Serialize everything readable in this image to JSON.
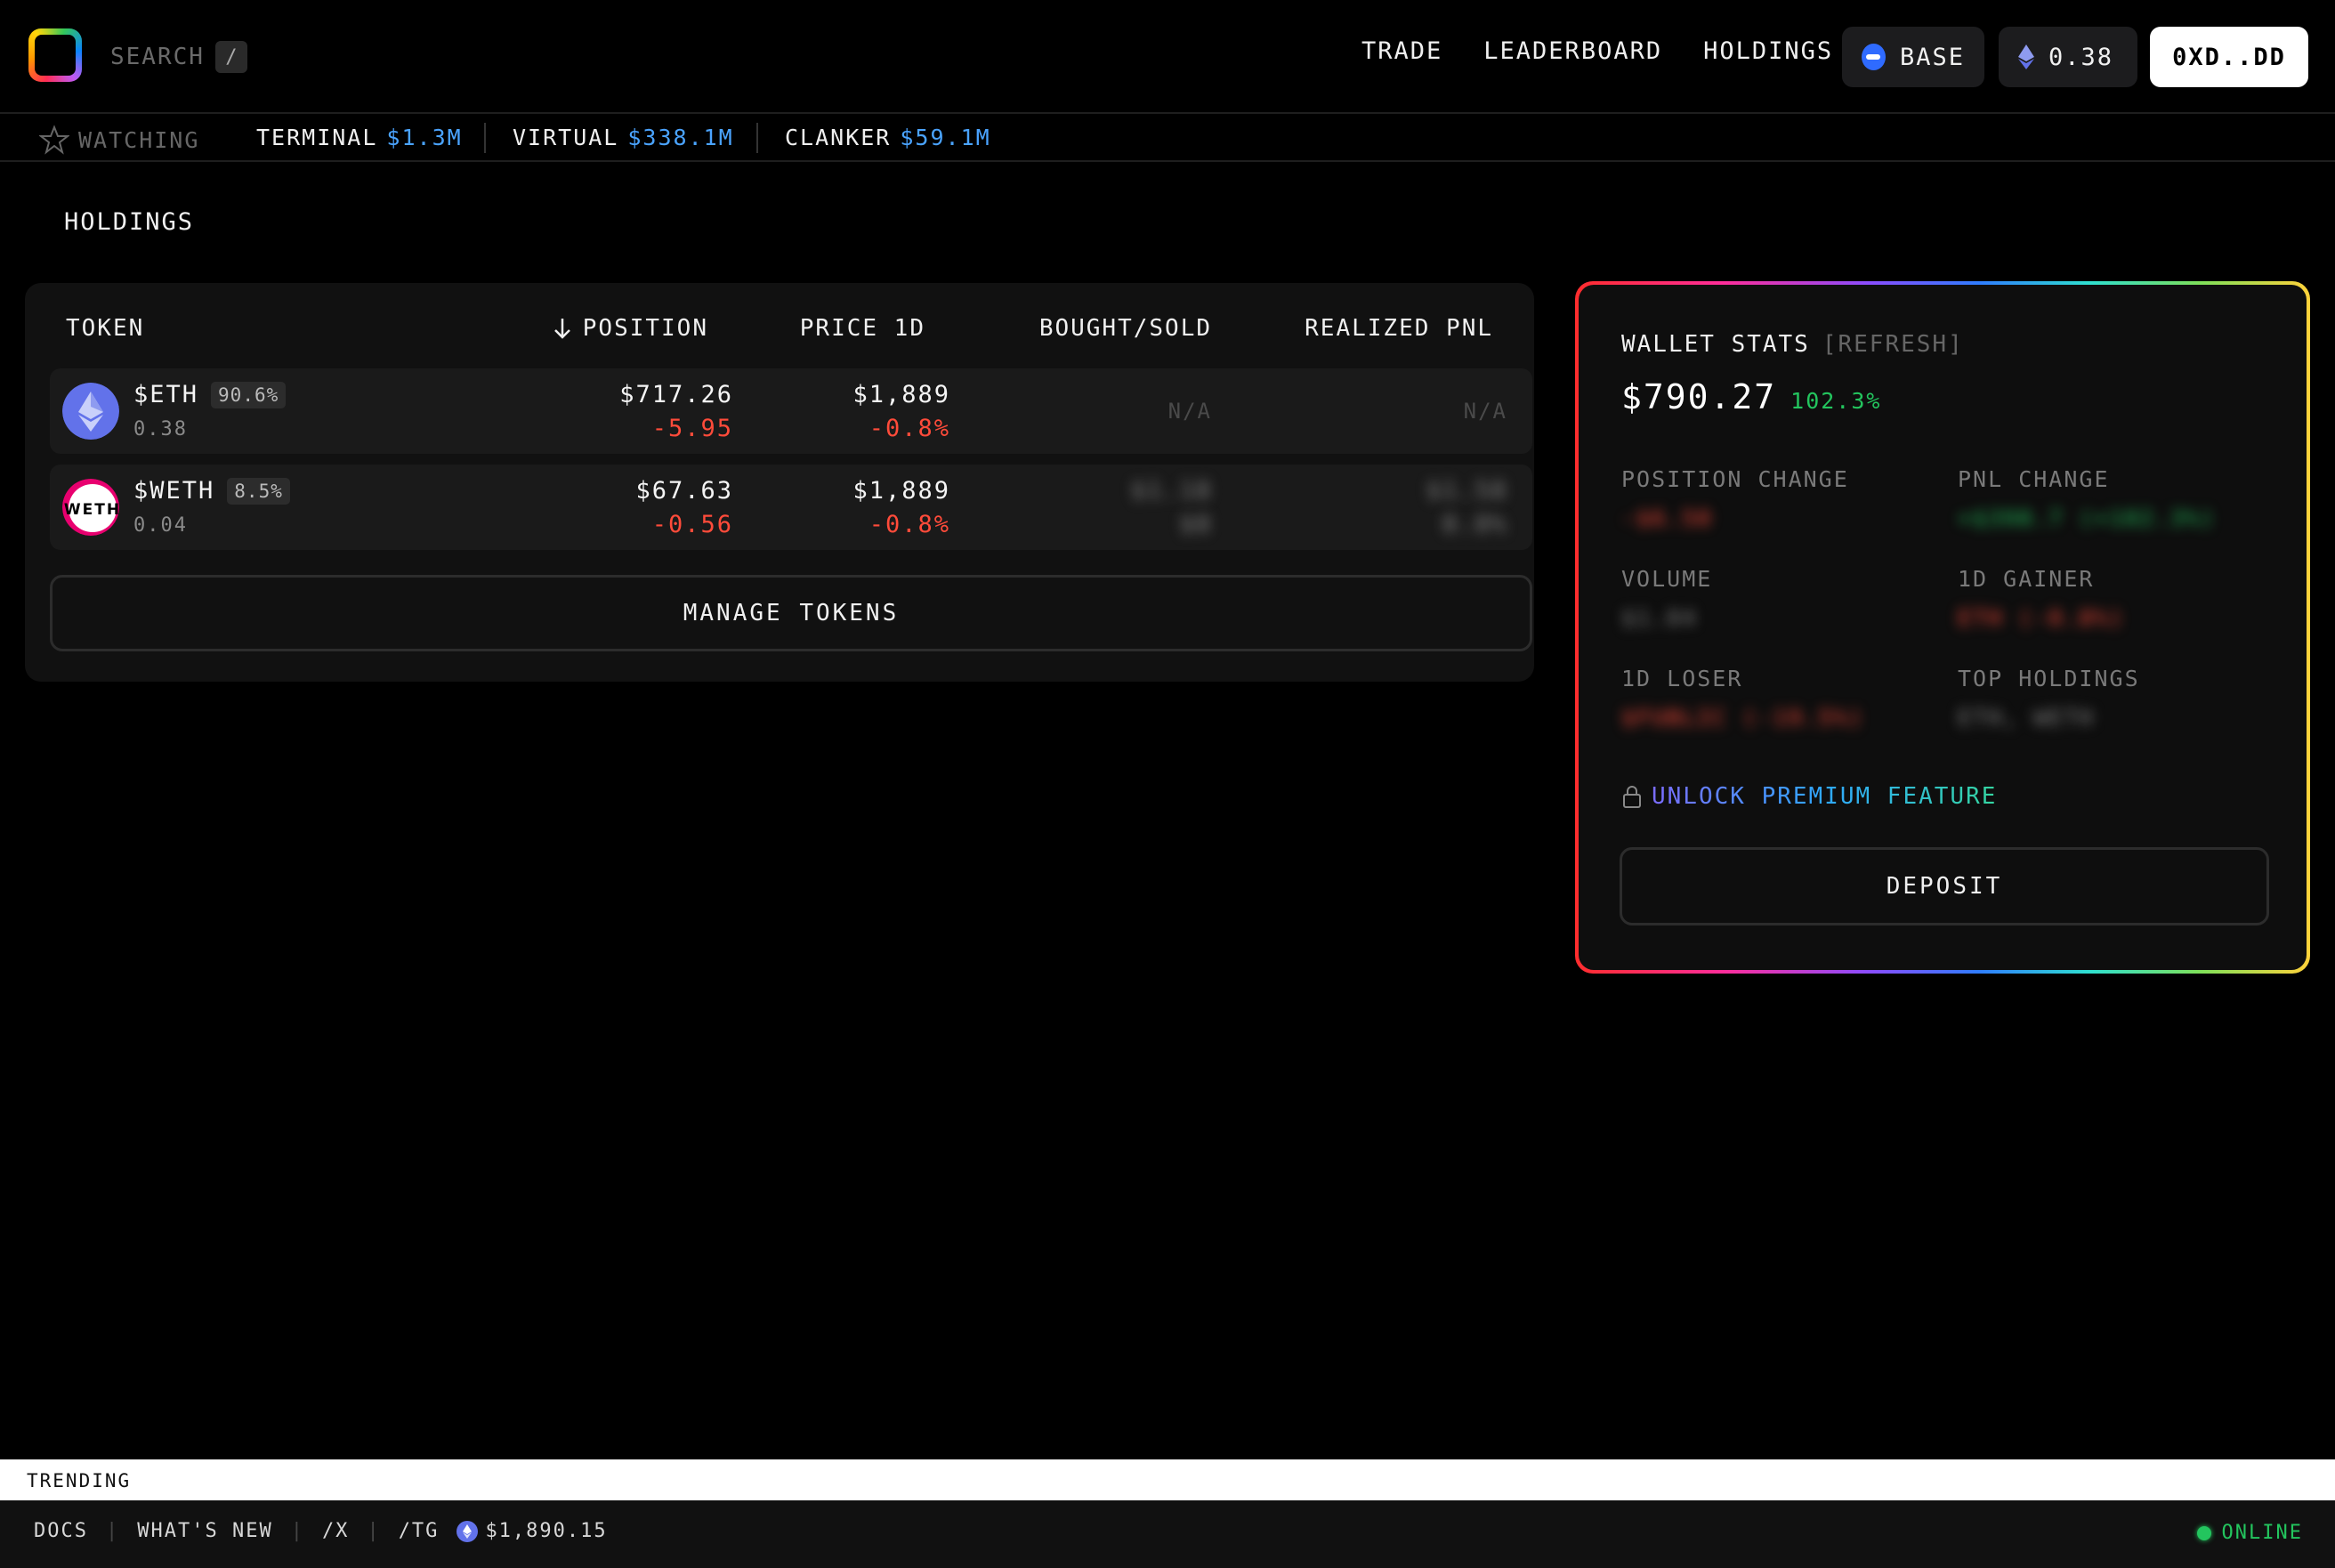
{
  "nav": {
    "search_label": "SEARCH",
    "search_shortcut": "/",
    "links": [
      "TRADE",
      "LEADERBOARD",
      "HOLDINGS"
    ],
    "network": "BASE",
    "eth_balance": "0.38",
    "wallet": "0XD..DD",
    "icons": {
      "logo": "rainbow-square-logo",
      "network": "base-icon",
      "balance": "eth-icon"
    }
  },
  "watchbar": {
    "label": "WATCHING",
    "tickers": [
      {
        "name": "TERMINAL",
        "value": "$1.3M"
      },
      {
        "name": "VIRTUAL",
        "value": "$338.1M"
      },
      {
        "name": "CLANKER",
        "value": "$59.1M"
      }
    ]
  },
  "page_title": "HOLDINGS",
  "holdings": {
    "columns": {
      "token": "TOKEN",
      "position": "POSITION",
      "price": "PRICE 1D",
      "bought_sold": "BOUGHT/SOLD",
      "realized": "REALIZED PNL"
    },
    "rows": [
      {
        "symbol": "$ETH",
        "share": "90.6%",
        "amount": "0.38",
        "position": "$717.26",
        "position_change": "-5.95",
        "price": "$1,889",
        "price_change": "-0.8%",
        "bought": "N/A",
        "bought_sub": "",
        "realized": "N/A",
        "realized_sub": "",
        "icon": "eth-logo"
      },
      {
        "symbol": "$WETH",
        "share": "8.5%",
        "amount": "0.04",
        "position": "$67.63",
        "position_change": "-0.56",
        "price": "$1,889",
        "price_change": "-0.8%",
        "bought": "$1.18",
        "bought_sub": "$0",
        "realized": "$1.58",
        "realized_sub": "0.0%",
        "icon": "weth-logo"
      }
    ],
    "manage_label": "MANAGE TOKENS"
  },
  "wallet_stats": {
    "title": "WALLET STATS",
    "refresh": "[REFRESH]",
    "total": "$790.27",
    "total_pct": "102.3%",
    "stats": [
      {
        "label": "POSITION CHANGE",
        "value": "-$6.50"
      },
      {
        "label": "PNL CHANGE",
        "value": "+$398.7 (+102.3%)"
      },
      {
        "label": "VOLUME",
        "value": "$1.04"
      },
      {
        "label": "1D GAINER",
        "value": "ETH (-0.8%)"
      },
      {
        "label": "1D LOSER",
        "value": "$FUBLIC (-19.5%)"
      },
      {
        "label": "TOP HOLDINGS",
        "value": "ETH, WETH"
      }
    ],
    "unlock_label": "UNLOCK PREMIUM FEATURE",
    "deposit_label": "DEPOSIT"
  },
  "trending_label": "TRENDING",
  "footer": {
    "links": [
      "DOCS",
      "WHAT'S NEW",
      "/X",
      "/TG"
    ],
    "eth_price": "$1,890.15",
    "status": "ONLINE"
  },
  "colors": {
    "accent_blue": "#4aa3ff",
    "positive": "#23c55e",
    "negative": "#ff4b3a",
    "base_blue": "#2f6bff"
  }
}
